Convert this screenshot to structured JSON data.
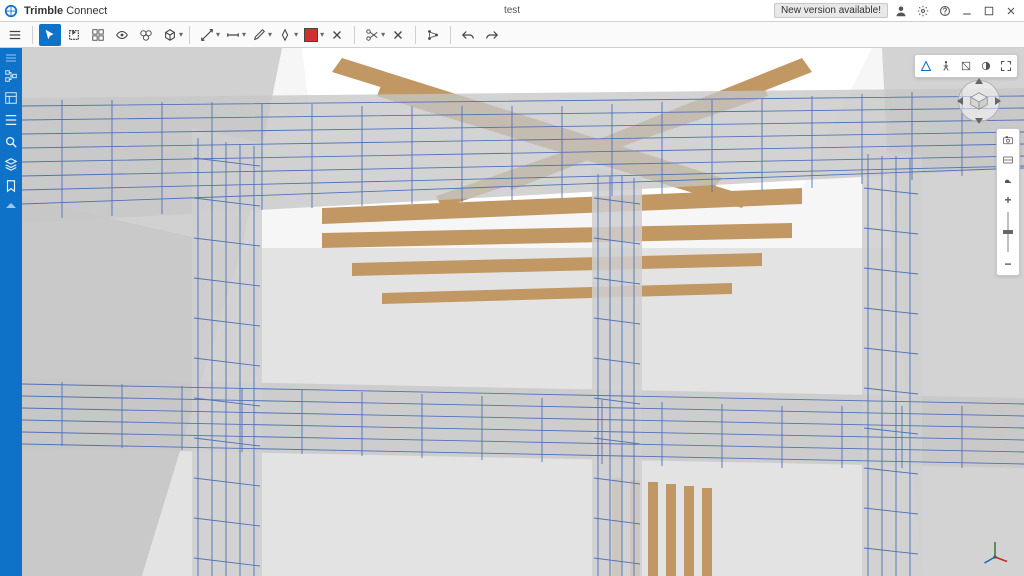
{
  "app": {
    "brand": "Trimble",
    "name": "Connect"
  },
  "project": "test",
  "newVersion": "New version available!",
  "colors": {
    "brand": "#0e72c9",
    "swatch": "#d32f2f",
    "wire": "#4a6db8",
    "concrete": "#d4d4d4",
    "wood": "#c19764"
  },
  "toolbar": {
    "menu": "menu",
    "pointer": "pointer",
    "fitselect": "fitselect",
    "selbox": "selbox",
    "visibility": "visibility",
    "materials": "materials",
    "cube": "cube",
    "measure": "measure",
    "dims": "dims",
    "pencil": "pencil",
    "pen": "pen",
    "color": "color",
    "erase": "erase",
    "scissors": "scissors",
    "branch": "branch",
    "undo": "undo",
    "redo": "redo"
  },
  "leftpanel": {
    "items": [
      {
        "name": "grip"
      },
      {
        "name": "model-tree"
      },
      {
        "name": "views"
      },
      {
        "name": "properties"
      },
      {
        "name": "search"
      },
      {
        "name": "layers"
      },
      {
        "name": "bookmarks"
      },
      {
        "name": "more-grip"
      }
    ]
  },
  "viewtoolsTop": {
    "items": [
      {
        "name": "perspective"
      },
      {
        "name": "walk"
      },
      {
        "name": "section"
      },
      {
        "name": "shading"
      },
      {
        "name": "fullscreen"
      }
    ]
  },
  "rightPanel": {
    "items": [
      {
        "name": "camera"
      },
      {
        "name": "mode"
      },
      {
        "name": "sky"
      }
    ]
  },
  "zoom": {
    "plus": "+",
    "minus": "−"
  }
}
